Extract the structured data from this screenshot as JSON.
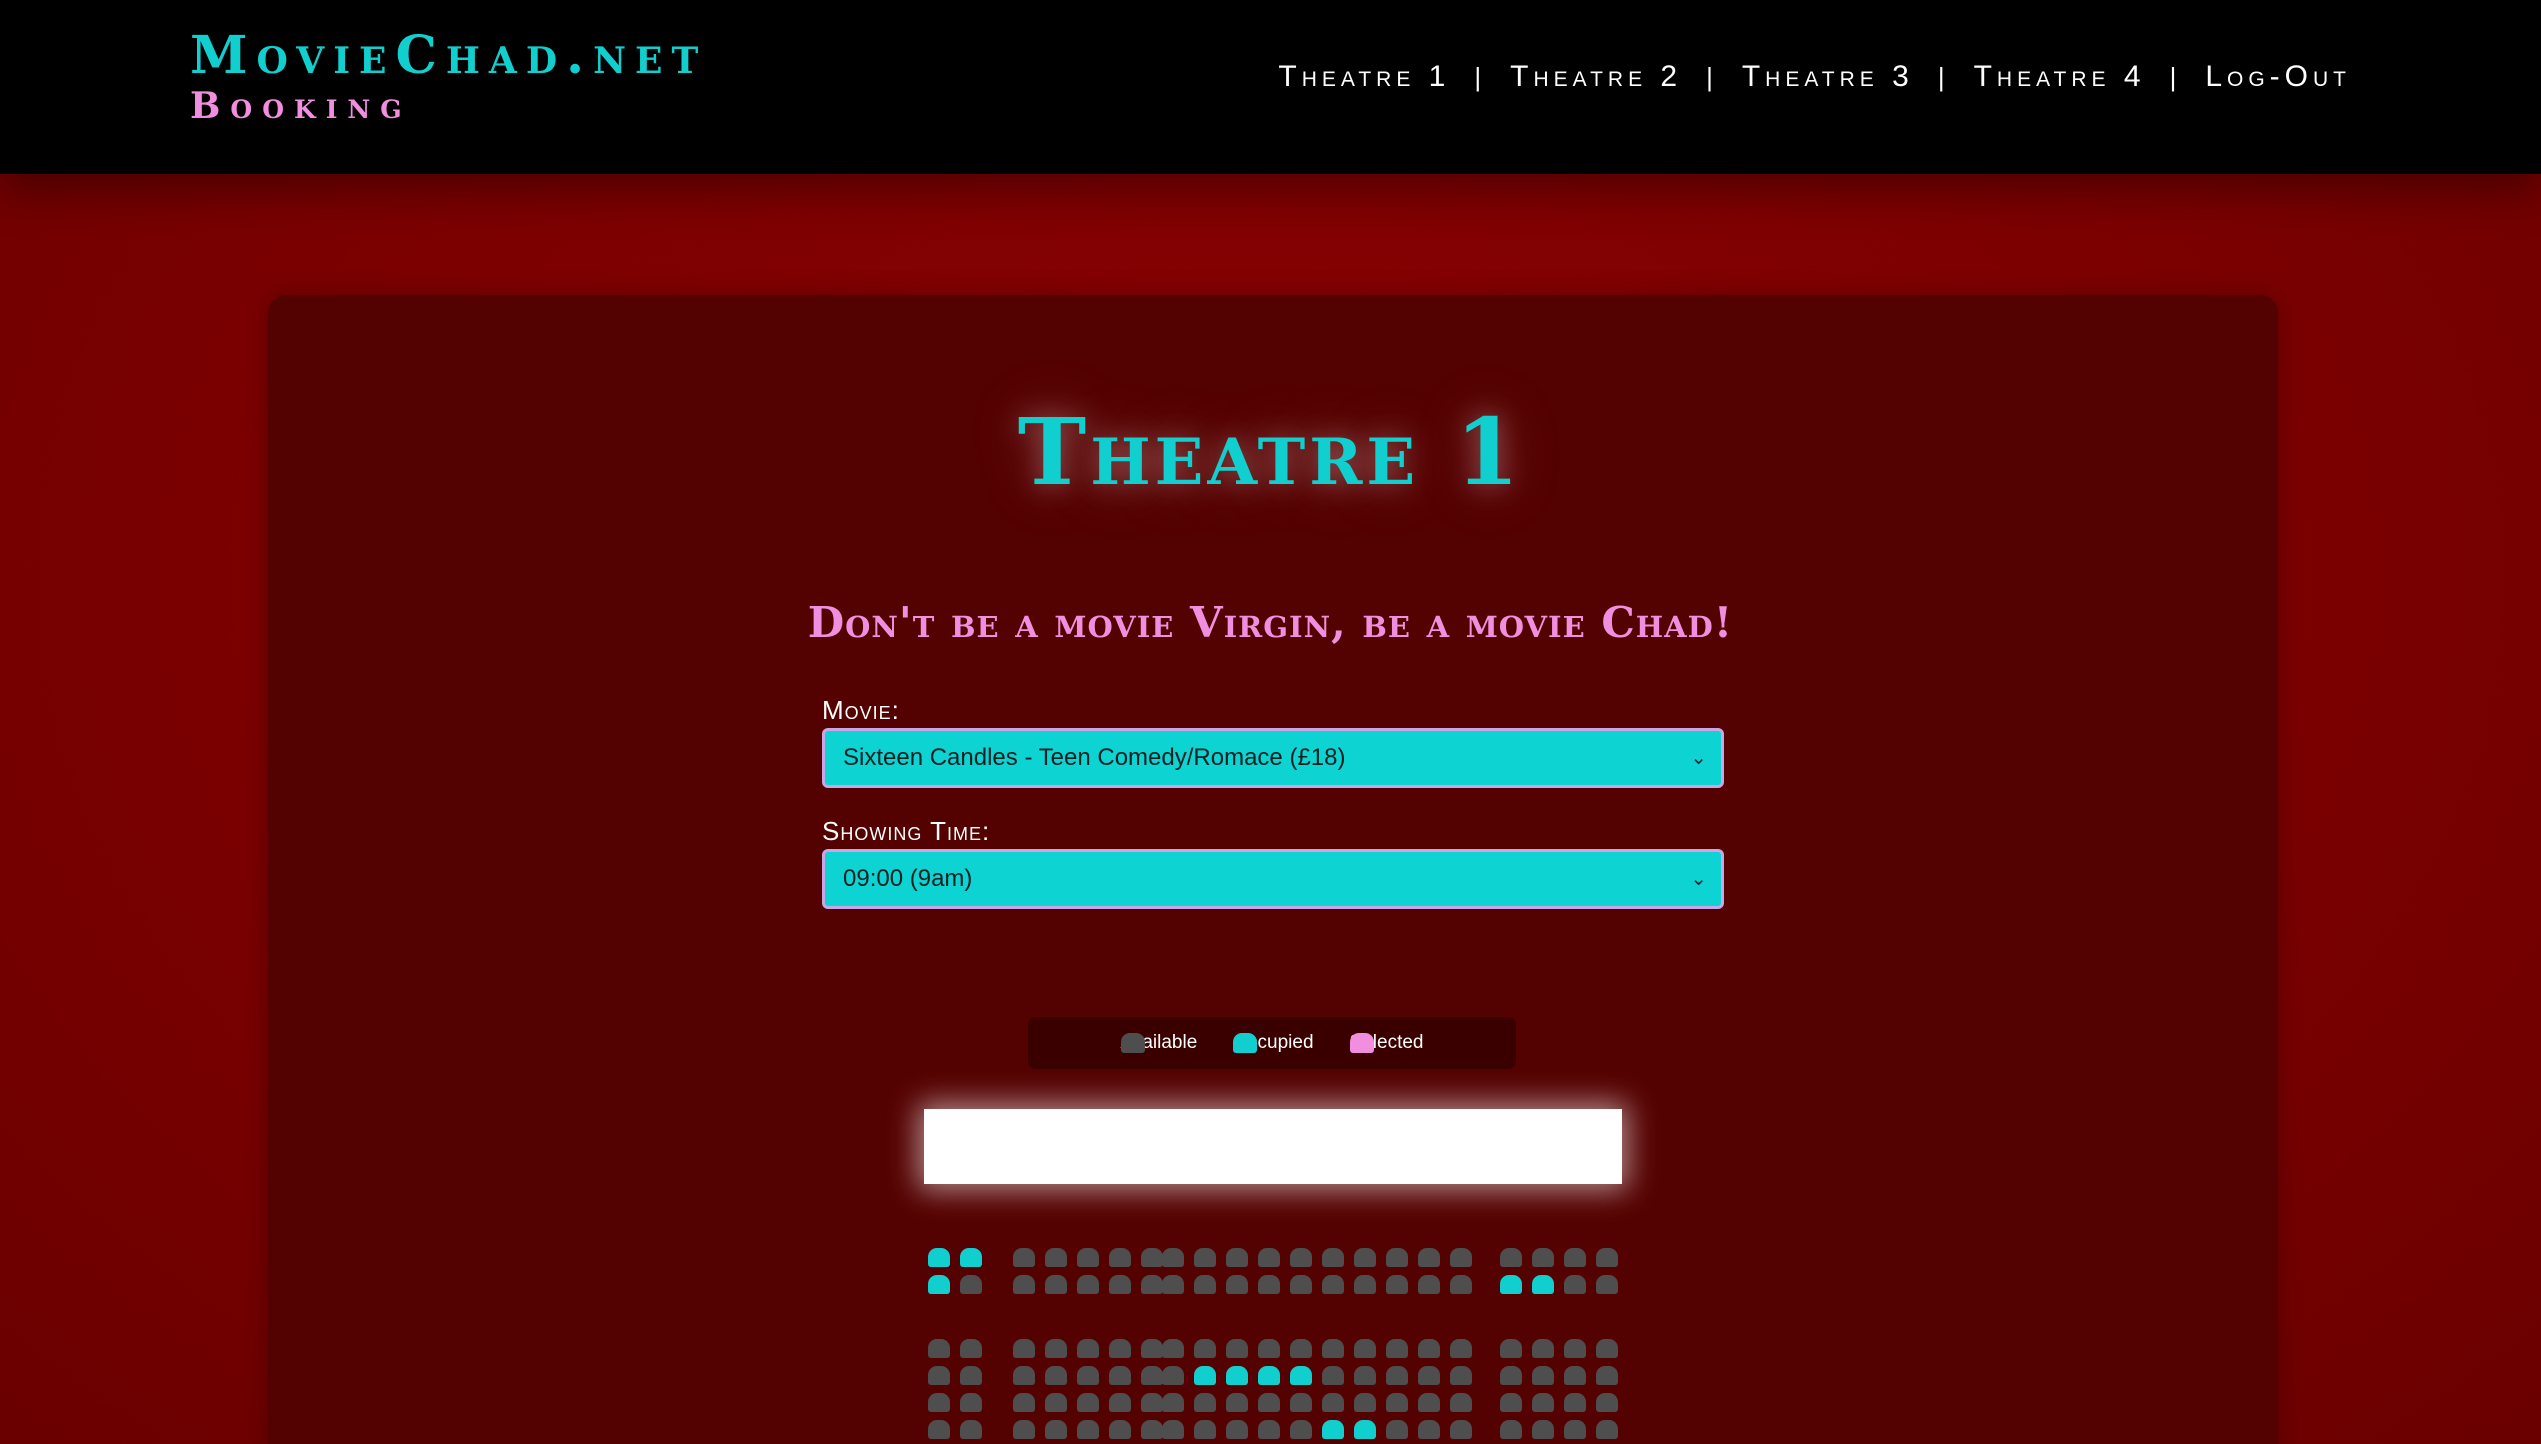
{
  "header": {
    "brand_title": "MovieChad.net",
    "brand_subtitle": "Booking",
    "nav": [
      "Theatre 1",
      "Theatre 2",
      "Theatre 3",
      "Theatre 4",
      "Log-Out"
    ],
    "nav_separator": "|"
  },
  "main": {
    "title": "Theatre 1",
    "tagline": "Don't be a movie Virgin, be a movie Chad!",
    "movie_label": "Movie:",
    "movie_value": "Sixteen Candles - Teen Comedy/Romace (£18)",
    "time_label": "Showing Time:",
    "time_value": "09:00 (9am)"
  },
  "legend": {
    "available": "Available",
    "occupied": "Occupied",
    "selected": "Selected"
  },
  "colors": {
    "accent": "#12cfcf",
    "pink": "#f28ee0",
    "available": "#4e4e4e",
    "background": "#7a0000",
    "panel": "#540101"
  },
  "seating": {
    "sections": [
      {
        "rows": [
          [
            1,
            1
          ],
          [
            1,
            0
          ]
        ]
      },
      {
        "rows": [
          [
            0,
            0,
            0,
            0,
            0
          ],
          [
            0,
            0,
            0,
            0,
            0
          ]
        ]
      },
      {
        "rows": [
          [
            0,
            0,
            0,
            0,
            0,
            0,
            0,
            0,
            0,
            0
          ],
          [
            0,
            0,
            0,
            0,
            0,
            0,
            0,
            0,
            0,
            0
          ]
        ]
      },
      {
        "rows": [
          [
            0,
            0,
            0,
            0
          ],
          [
            1,
            1,
            0,
            0
          ]
        ]
      },
      {
        "rows": [
          [
            0,
            0
          ],
          [
            0,
            0
          ],
          [
            0,
            0
          ],
          [
            0,
            0
          ]
        ]
      },
      {
        "rows": [
          [
            0,
            0,
            0,
            0,
            0
          ],
          [
            0,
            0,
            0,
            0,
            0
          ],
          [
            0,
            0,
            0,
            0,
            0
          ],
          [
            0,
            0,
            0,
            0,
            0
          ]
        ]
      },
      {
        "rows": [
          [
            0,
            0,
            0,
            0,
            0,
            0,
            0,
            0,
            0,
            0
          ],
          [
            0,
            1,
            1,
            1,
            1,
            0,
            0,
            0,
            0,
            0
          ],
          [
            0,
            0,
            0,
            0,
            0,
            0,
            0,
            0,
            0,
            0
          ],
          [
            0,
            0,
            0,
            0,
            0,
            1,
            1,
            0,
            0,
            0
          ]
        ]
      },
      {
        "rows": [
          [
            0,
            0,
            0,
            0
          ],
          [
            0,
            0,
            0,
            0
          ],
          [
            0,
            0,
            0,
            0
          ],
          [
            0,
            0,
            0,
            0
          ]
        ]
      }
    ]
  }
}
